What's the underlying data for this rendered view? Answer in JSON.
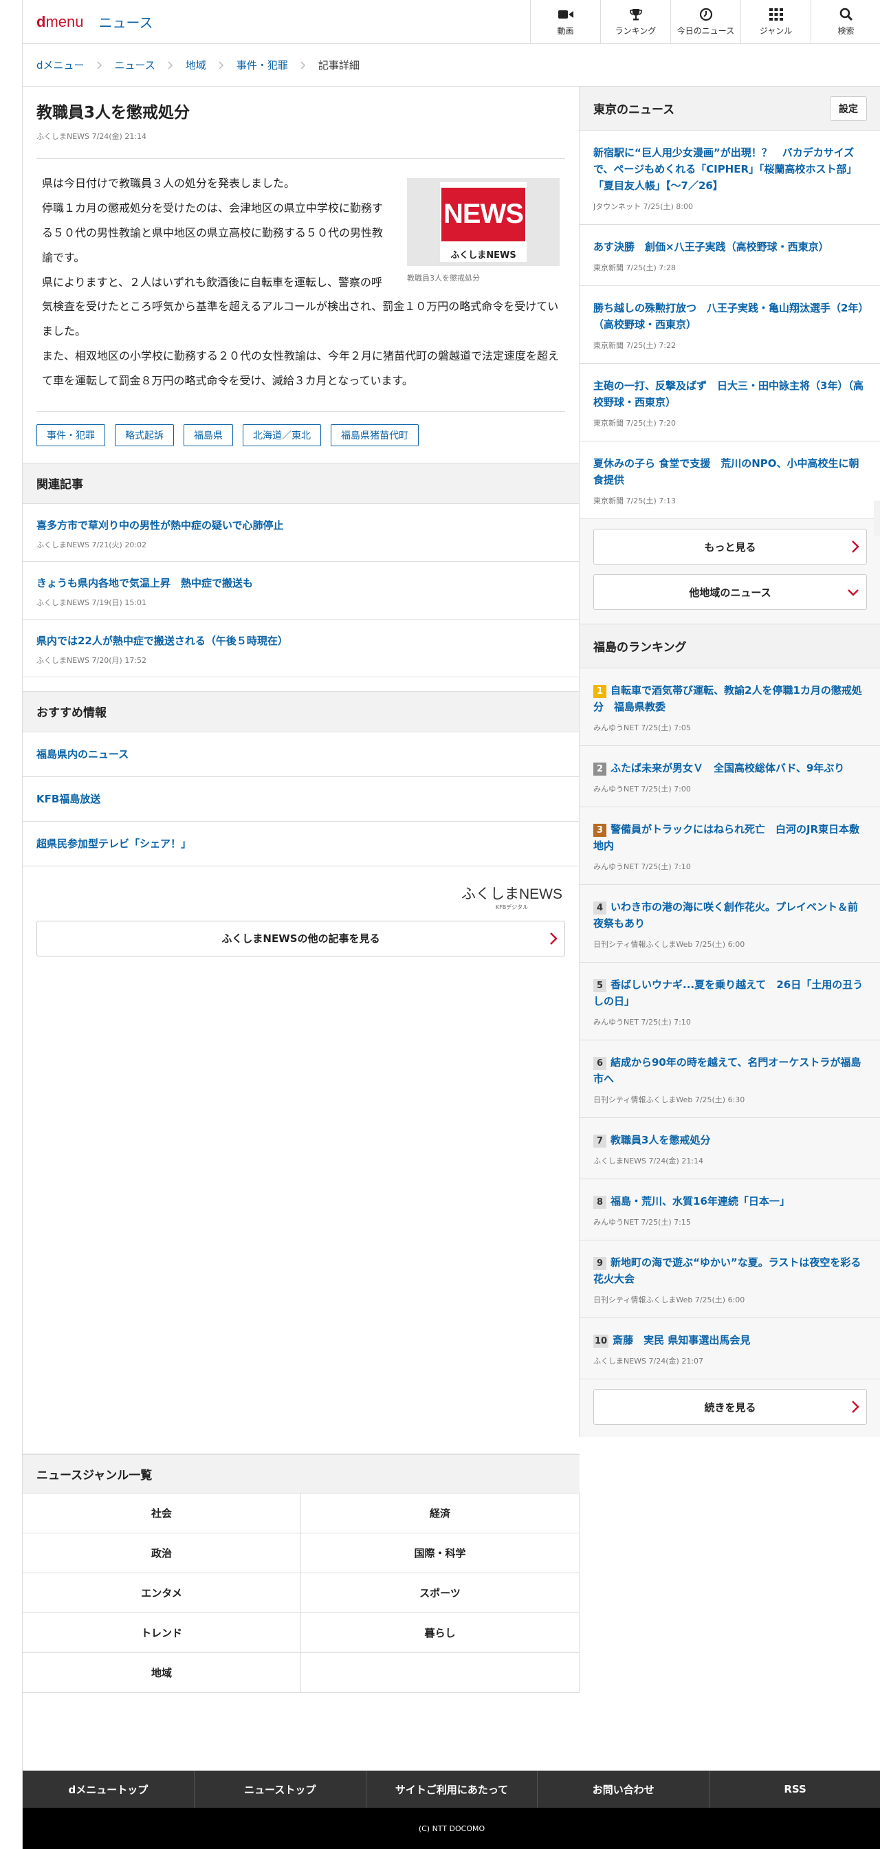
{
  "header": {
    "logo_d": "d",
    "logo_menu": "menu",
    "section": "ニュース",
    "nav": [
      {
        "label": "動画",
        "icon": "video-icon"
      },
      {
        "label": "ランキング",
        "icon": "trophy-icon"
      },
      {
        "label": "今日のニュース",
        "icon": "clock-icon"
      },
      {
        "label": "ジャンル",
        "icon": "grid-icon"
      },
      {
        "label": "検索",
        "icon": "search-icon"
      }
    ]
  },
  "breadcrumb": [
    "dメニュー",
    "ニュース",
    "地域",
    "事件・犯罪",
    "記事詳細"
  ],
  "article": {
    "title": "教職員3人を懲戒処分",
    "meta": "ふくしまNEWS 7/24(金) 21:14",
    "image": {
      "label": "NEWS",
      "brand": "ふくしまNEWS",
      "caption": "教職員3人を懲戒処分"
    },
    "paragraphs": [
      "県は今日付けで教職員３人の処分を発表しました。",
      "停職１カ月の懲戒処分を受けたのは、会津地区の県立中学校に勤務する５０代の男性教諭と県中地区の県立高校に勤務する５０代の男性教諭です。",
      "県によりますと、２人はいずれも飲酒後に自転車を運転し、警察の呼気検査を受けたところ呼気から基準を超えるアルコールが検出され、罰金１０万円の略式命令を受けていました。",
      "また、相双地区の小学校に勤務する２０代の女性教諭は、今年２月に猪苗代町の磐越道で法定速度を超えて車を運転して罰金８万円の略式命令を受け、減給３カ月となっています。"
    ],
    "tags": [
      "事件・犯罪",
      "略式起訴",
      "福島県",
      "北海道／東北",
      "福島県猪苗代町"
    ]
  },
  "related": {
    "heading": "関連記事",
    "items": [
      {
        "title": "喜多方市で草刈り中の男性が熱中症の疑いで心肺停止",
        "meta": "ふくしまNEWS 7/21(火) 20:02"
      },
      {
        "title": "きょうも県内各地で気温上昇　熱中症で搬送も",
        "meta": "ふくしまNEWS 7/19(日) 15:01"
      },
      {
        "title": "県内では22人が熱中症で搬送される（午後５時現在）",
        "meta": "ふくしまNEWS 7/20(月) 17:52"
      }
    ]
  },
  "recommend": {
    "heading": "おすすめ情報",
    "items": [
      "福島県内のニュース",
      "KFB福島放送",
      "超県民参加型テレビ「シェア！」"
    ]
  },
  "source_logo": {
    "name": "ふくしまNEWS",
    "sub": "KFBデジタル"
  },
  "more_source": "ふくしまNEWSの他の記事を見る",
  "tokyo": {
    "heading": "東京のニュース",
    "settings": "設定",
    "items": [
      {
        "title": "新宿駅に“巨人用少女漫画”が出現！？　バカデカサイズで、ページもめくれる「CIPHER」「桜蘭高校ホスト部」「夏目友人帳」【～7／26】",
        "meta": "Jタウンネット 7/25(土) 8:00"
      },
      {
        "title": "あす決勝　創価×八王子実践（高校野球・西東京）",
        "meta": "東京新聞 7/25(土) 7:28"
      },
      {
        "title": "勝ち越しの殊勲打放つ　八王子実践・亀山翔汰選手（2年）（高校野球・西東京）",
        "meta": "東京新聞 7/25(土) 7:22"
      },
      {
        "title": "主砲の一打、反撃及ばず　日大三・田中詠主将（3年）（高校野球・西東京）",
        "meta": "東京新聞 7/25(土) 7:20"
      },
      {
        "title": "夏休みの子ら 食堂で支援　荒川のNPO、小中高校生に朝食提供",
        "meta": "東京新聞 7/25(土) 7:13"
      }
    ],
    "more": "もっと見る",
    "other": "他地域のニュース"
  },
  "ranking": {
    "heading": "福島のランキング",
    "items": [
      {
        "no": "1",
        "title": "自転車で酒気帯び運転、教諭2人を停職1カ月の懲戒処分　福島県教委",
        "meta": "みんゆうNET 7/25(土) 7:05"
      },
      {
        "no": "2",
        "title": "ふたば未来が男女Ｖ　全国高校総体バド、9年ぶり",
        "meta": "みんゆうNET 7/25(土) 7:00"
      },
      {
        "no": "3",
        "title": "警備員がトラックにはねられ死亡　白河のJR東日本敷地内",
        "meta": "みんゆうNET 7/25(土) 7:10"
      },
      {
        "no": "4",
        "title": "いわき市の港の海に咲く創作花火。プレイベント＆前夜祭もあり",
        "meta": "日刊シティ情報ふくしまWeb 7/25(土) 6:00"
      },
      {
        "no": "5",
        "title": "香ばしいウナギ...夏を乗り越えて　26日「土用の丑うしの日」",
        "meta": "みんゆうNET 7/25(土) 7:10"
      },
      {
        "no": "6",
        "title": "結成から90年の時を越えて、名門オーケストラが福島市へ",
        "meta": "日刊シティ情報ふくしまWeb 7/25(土) 6:30"
      },
      {
        "no": "7",
        "title": "教職員3人を懲戒処分",
        "meta": "ふくしまNEWS 7/24(金) 21:14"
      },
      {
        "no": "8",
        "title": "福島・荒川、水質16年連続「日本一」",
        "meta": "みんゆうNET 7/25(土) 7:15"
      },
      {
        "no": "9",
        "title": "新地町の海で遊ぶ“ゆかい”な夏。ラストは夜空を彩る花火大会",
        "meta": "日刊シティ情報ふくしまWeb 7/25(土) 6:00"
      },
      {
        "no": "10",
        "title": "斎藤　実民 県知事選出馬会見",
        "meta": "ふくしまNEWS 7/24(金) 21:07"
      }
    ],
    "more": "続きを見る"
  },
  "genres": {
    "heading": "ニュースジャンル一覧",
    "items": [
      "社会",
      "経済",
      "政治",
      "国際・科学",
      "エンタメ",
      "スポーツ",
      "トレンド",
      "暮らし",
      "地域",
      ""
    ]
  },
  "footer": {
    "nav": [
      "dメニュートップ",
      "ニューストップ",
      "サイトご利用にあたって",
      "お問い合わせ",
      "RSS"
    ],
    "copyright": "(C) NTT DOCOMO"
  },
  "colors": {
    "link": "#0b63a8",
    "brand_red": "#c8102e",
    "rank1": "#f3b600",
    "rank2": "#8f8f8f",
    "rank3": "#b86b22"
  }
}
